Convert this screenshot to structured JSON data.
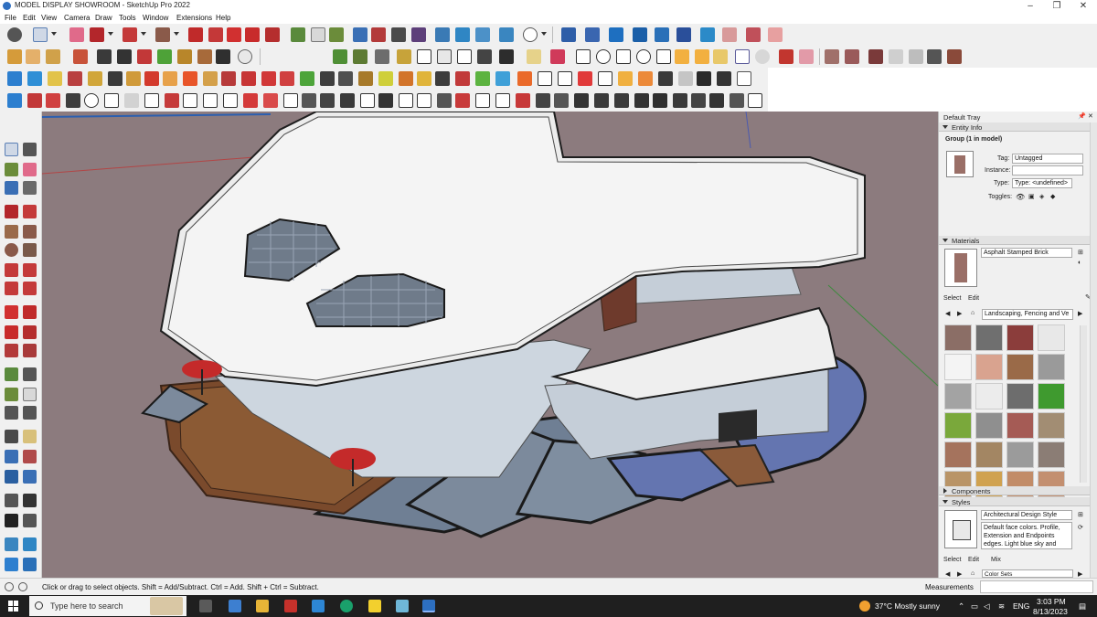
{
  "window": {
    "title": "MODEL DISPLAY SHOWROOM - SketchUp Pro 2022",
    "minimize": "–",
    "maximize": "❐",
    "close": "✕"
  },
  "menu": [
    "File",
    "Edit",
    "View",
    "Camera",
    "Draw",
    "Tools",
    "Window",
    "Extensions",
    "Help"
  ],
  "tray": {
    "title": "Default Tray",
    "entity_info": {
      "header": "Entity Info",
      "selection": "Group (1 in model)",
      "tag_label": "Tag:",
      "tag_value": "Untagged",
      "instance_label": "Instance:",
      "instance_value": "",
      "type_label": "Type:",
      "type_value": "Type: <undefined>",
      "toggles_label": "Toggles:"
    },
    "materials": {
      "header": "Materials",
      "current_name": "Asphalt Stamped Brick",
      "tab_select": "Select",
      "tab_edit": "Edit",
      "library": "Landscaping, Fencing and Ve",
      "swatch_colors": [
        "#8b6e66",
        "#6f6f6f",
        "#8b3d3b",
        "#e8e8e8",
        "#f4f4f4",
        "#d9a38f",
        "#9a6a48",
        "#9a9a9a",
        "#a3a3a3",
        "#ececec",
        "#6d6d6d",
        "#3f9a2f",
        "#7aa83b",
        "#8f8f8f",
        "#a55b55",
        "#a28d73",
        "#a5735d",
        "#a38663",
        "#9b9b9b",
        "#8b7d75",
        "#b99467",
        "#d0a250",
        "#c28c68",
        "#c38f70"
      ]
    },
    "components": {
      "header": "Components"
    },
    "styles": {
      "header": "Styles",
      "name": "Architectural Design Style",
      "description": "Default face colors. Profile, Extension and Endpoints edges. Light blue sky and gray",
      "tab_select": "Select",
      "tab_edit": "Edit",
      "tab_mix": "Mix",
      "collection": "Color Sets"
    }
  },
  "status": {
    "hint": "Click or drag to select objects. Shift = Add/Subtract. Ctrl = Add. Shift + Ctrl = Subtract.",
    "measurements_label": "Measurements"
  },
  "taskbar": {
    "search_placeholder": "Type here to search",
    "weather": "37°C  Mostly sunny",
    "language": "ENG",
    "time": "3:03 PM",
    "date": "8/13/2023"
  },
  "colors": {
    "viewport_bg": "#8c7b7e",
    "toolbar_bg": "#f0f0f0",
    "selection_blue": "#2b5fb0",
    "taskbar_bg": "#1f1f1f"
  }
}
